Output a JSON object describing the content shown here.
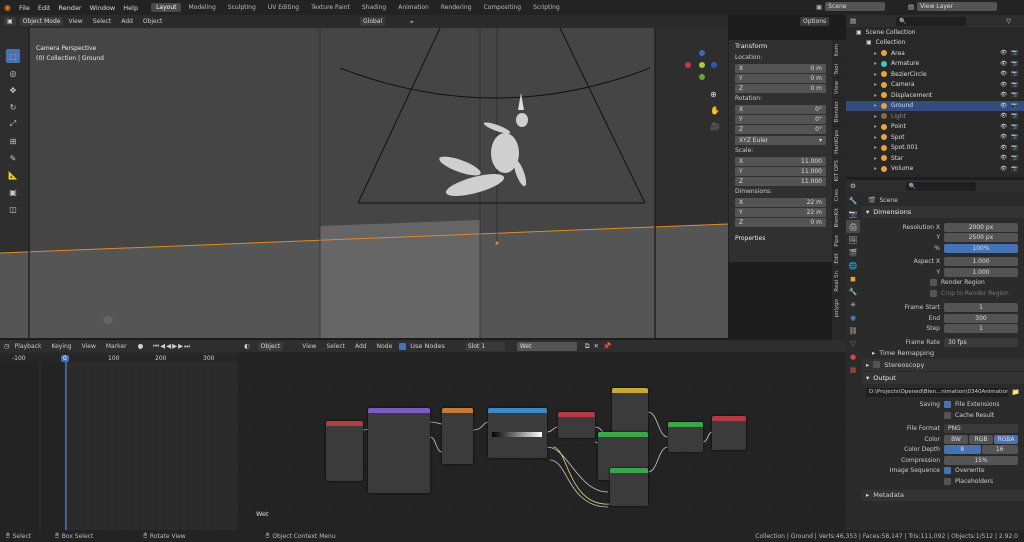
{
  "topbar": {
    "menus": [
      "File",
      "Edit",
      "Render",
      "Window",
      "Help"
    ],
    "workspaces": [
      "Layout",
      "Modeling",
      "Sculpting",
      "UV Editing",
      "Texture Paint",
      "Shading",
      "Animation",
      "Rendering",
      "Compositing",
      "Scripting"
    ],
    "active_workspace": "Layout",
    "scene": "Scene",
    "view_layer": "View Layer"
  },
  "viewport": {
    "mode": "Object Mode",
    "menus": [
      "View",
      "Select",
      "Add",
      "Object"
    ],
    "transform_orient": "Global",
    "options": "Options",
    "overlay_title": "Camera Perspective",
    "overlay_sub": "(0) Collection | Ground"
  },
  "npanel": {
    "section": "Transform",
    "location_label": "Location:",
    "location": [
      {
        "axis": "X",
        "value": "0 m"
      },
      {
        "axis": "Y",
        "value": "0 m"
      },
      {
        "axis": "Z",
        "value": "0 m"
      }
    ],
    "rotation_label": "Rotation:",
    "rotation": [
      {
        "axis": "X",
        "value": "0°"
      },
      {
        "axis": "Y",
        "value": "0°"
      },
      {
        "axis": "Z",
        "value": "0°"
      }
    ],
    "rotation_mode": "XYZ Euler",
    "scale_label": "Scale:",
    "scale": [
      {
        "axis": "X",
        "value": "11.000"
      },
      {
        "axis": "Y",
        "value": "11.000"
      },
      {
        "axis": "Z",
        "value": "11.000"
      }
    ],
    "dimensions_label": "Dimensions:",
    "dimensions": [
      {
        "axis": "X",
        "value": "22 m"
      },
      {
        "axis": "Y",
        "value": "22 m"
      },
      {
        "axis": "Z",
        "value": "0 m"
      }
    ],
    "properties": "Properties"
  },
  "vtabs": [
    "Item",
    "Tool",
    "View",
    "Blender",
    "HardOps",
    "KIT OPS",
    "Cres",
    "BlenKit",
    "Pipe",
    "Edit",
    "Real Sn",
    "polygo"
  ],
  "outliner": {
    "scene_collection": "Scene Collection",
    "collection": "Collection",
    "items": [
      {
        "name": "Area",
        "color": "#e8a33a"
      },
      {
        "name": "Armature",
        "color": "#3ad0b8"
      },
      {
        "name": "BezierCircle",
        "color": "#e8a33a"
      },
      {
        "name": "Camera",
        "color": "#e8a33a"
      },
      {
        "name": "Displacement",
        "color": "#e8a33a"
      },
      {
        "name": "Ground",
        "color": "#e8a33a",
        "selected": true
      },
      {
        "name": "Light",
        "color": "#8a6a3a"
      },
      {
        "name": "Point",
        "color": "#e8a33a"
      },
      {
        "name": "Spot",
        "color": "#e8a33a"
      },
      {
        "name": "Spot.001",
        "color": "#e8a33a"
      },
      {
        "name": "Star",
        "color": "#e8a33a"
      },
      {
        "name": "Volume",
        "color": "#e8a33a"
      }
    ]
  },
  "props": {
    "context": "Scene",
    "dimensions": "Dimensions",
    "res_x_label": "Resolution X",
    "res_x": "2000 px",
    "res_y_label": "Y",
    "res_y": "2500 px",
    "pct_label": "%",
    "pct": "100%",
    "aspect_x_label": "Aspect X",
    "aspect_x": "1.000",
    "aspect_y_label": "Y",
    "aspect_y": "1.000",
    "render_region": "Render Region",
    "crop_region": "Crop to Render Region",
    "frame_start_label": "Frame Start",
    "frame_start": "1",
    "end_label": "End",
    "end": "300",
    "step_label": "Step",
    "step": "1",
    "frame_rate_label": "Frame Rate",
    "frame_rate": "30 fps",
    "time_remap": "Time Remapping",
    "stereoscopy": "Stereoscopy",
    "output": "Output",
    "path": "D:\\Projects\\Opened\\Blen...nimation\\0340Animation",
    "saving_label": "Saving",
    "file_ext": "File Extensions",
    "cache_result": "Cache Result",
    "file_format_label": "File Format",
    "file_format": "PNG",
    "color_label": "Color",
    "color_opts": [
      "BW",
      "RGB",
      "RGBA"
    ],
    "depth_label": "Color Depth",
    "depth_opts": [
      "8",
      "16"
    ],
    "compression_label": "Compression",
    "compression": "15%",
    "img_seq_label": "Image Sequence",
    "overwrite": "Overwrite",
    "placeholders": "Placeholders",
    "metadata": "Metadata"
  },
  "timeline": {
    "menus": [
      "Playback",
      "Keying",
      "View",
      "Marker"
    ],
    "ticks": [
      "-100",
      "0",
      "100",
      "200",
      "300"
    ],
    "current": "0"
  },
  "node_editor": {
    "type": "Object",
    "menus": [
      "View",
      "Select",
      "Add",
      "Node"
    ],
    "use_nodes": "Use Nodes",
    "slot": "Slot 1",
    "material": "Wet",
    "footer_label": "Wet"
  },
  "statusbar": {
    "select": "Select",
    "box_select": "Box Select",
    "rotate": "Rotate View",
    "ctx_menu": "Object Context Menu",
    "stats": "Collection | Ground | Verts:46,353 | Faces:58,147 | Tris:111,092 | Objects:1/512 | 2.92.0"
  }
}
